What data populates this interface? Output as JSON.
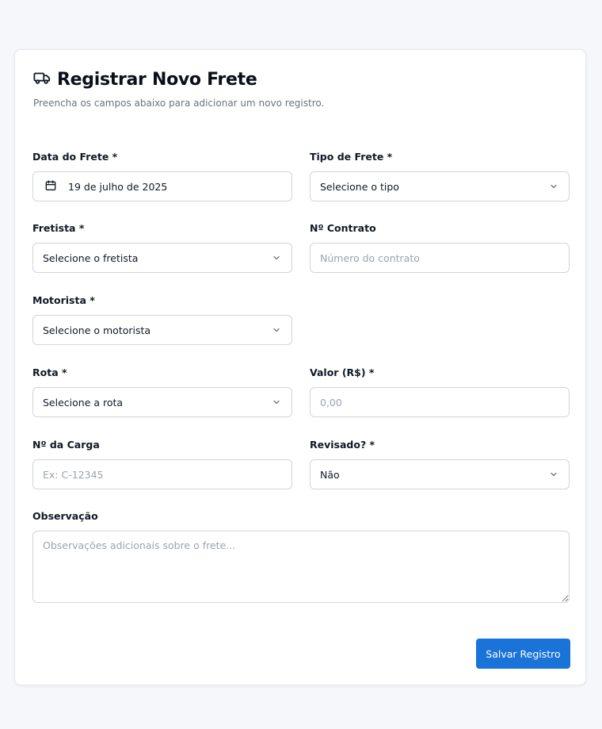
{
  "header": {
    "icon": "truck-icon",
    "title": "Registrar Novo Frete",
    "subtitle": "Preencha os campos abaixo para adicionar um novo registro."
  },
  "form": {
    "data_frete": {
      "label": "Data do Frete *",
      "value": "19 de julho de 2025",
      "icon": "calendar-icon"
    },
    "tipo_frete": {
      "label": "Tipo de Frete *",
      "value": "Selecione o tipo"
    },
    "fretista": {
      "label": "Fretista *",
      "value": "Selecione o fretista"
    },
    "contrato": {
      "label": "Nº Contrato",
      "placeholder": "Número do contrato"
    },
    "motorista": {
      "label": "Motorista *",
      "value": "Selecione o motorista"
    },
    "rota": {
      "label": "Rota *",
      "value": "Selecione a rota"
    },
    "valor": {
      "label": "Valor (R$) *",
      "placeholder": "0,00"
    },
    "carga": {
      "label": "Nº da Carga",
      "placeholder": "Ex: C-12345"
    },
    "revisado": {
      "label": "Revisado? *",
      "value": "Não"
    },
    "observacao": {
      "label": "Observação",
      "placeholder": "Observações adicionais sobre o frete..."
    }
  },
  "actions": {
    "save_label": "Salvar Registro"
  },
  "colors": {
    "primary": "#1a73d9",
    "border": "#d1d5db",
    "background": "#f5f7fa"
  }
}
